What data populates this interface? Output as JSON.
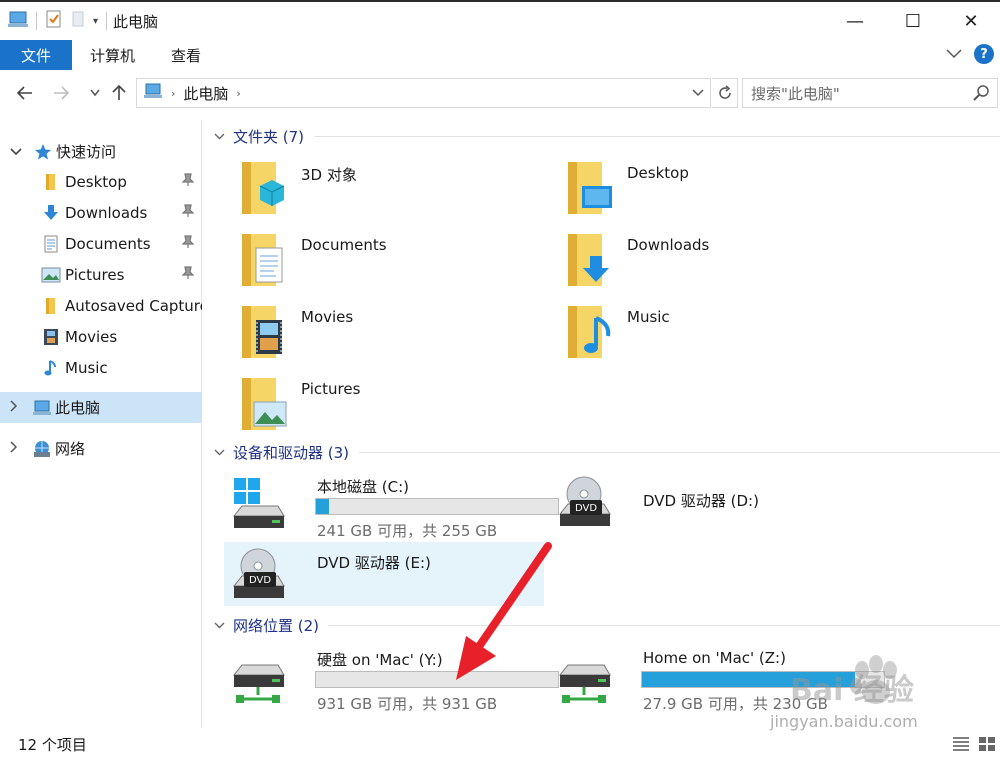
{
  "window": {
    "title": "此电脑",
    "controls": {
      "minimize": "—",
      "maximize": "☐",
      "close": "✕"
    }
  },
  "ribbon": {
    "file_tab": "文件",
    "tabs": [
      "计算机",
      "查看"
    ],
    "help": "?"
  },
  "address": {
    "path": "此电脑",
    "search_placeholder": "搜索\"此电脑\""
  },
  "sidebar": {
    "quick_access": "快速访问",
    "items": [
      {
        "label": "Desktop",
        "pinned": true
      },
      {
        "label": "Downloads",
        "pinned": true
      },
      {
        "label": "Documents",
        "pinned": true
      },
      {
        "label": "Pictures",
        "pinned": true
      },
      {
        "label": "Autosaved Captures",
        "pinned": false
      },
      {
        "label": "Movies",
        "pinned": false
      },
      {
        "label": "Music",
        "pinned": false
      }
    ],
    "this_pc": "此电脑",
    "network": "网络"
  },
  "groups": {
    "folders": "文件夹 (7)",
    "devices": "设备和驱动器 (3)",
    "network": "网络位置 (2)"
  },
  "folders": [
    {
      "name": "3D 对象",
      "icon": "3d-objects-folder-icon"
    },
    {
      "name": "Desktop",
      "icon": "desktop-folder-icon"
    },
    {
      "name": "Documents",
      "icon": "documents-folder-icon"
    },
    {
      "name": "Downloads",
      "icon": "downloads-folder-icon"
    },
    {
      "name": "Movies",
      "icon": "movies-folder-icon"
    },
    {
      "name": "Music",
      "icon": "music-folder-icon"
    },
    {
      "name": "Pictures",
      "icon": "pictures-folder-icon"
    }
  ],
  "drives": [
    {
      "name": "本地磁盘 (C:)",
      "used_fraction": 0.055,
      "free_text": "241 GB 可用，共 255 GB",
      "dvd_label": ""
    },
    {
      "name": "DVD 驱动器 (D:)",
      "dvd_label": "DVD"
    },
    {
      "name": "DVD 驱动器 (E:)",
      "dvd_label": "DVD"
    }
  ],
  "network_locations": [
    {
      "name": "硬盘 on 'Mac' (Y:)",
      "used_fraction": 0.0,
      "free_text": "931 GB 可用，共 931 GB"
    },
    {
      "name": "Home on 'Mac' (Z:)",
      "used_fraction": 0.88,
      "free_text": "27.9 GB 可用，共 230 GB"
    }
  ],
  "status": {
    "item_count": "12 个项目"
  },
  "watermark": {
    "brand": "Bai 经验",
    "url": "jingyan.baidu.com"
  },
  "colors": {
    "accent": "#1a73c8",
    "selection": "#cce4f7",
    "bar_fill": "#26a0da",
    "arrow": "#e8202a"
  }
}
